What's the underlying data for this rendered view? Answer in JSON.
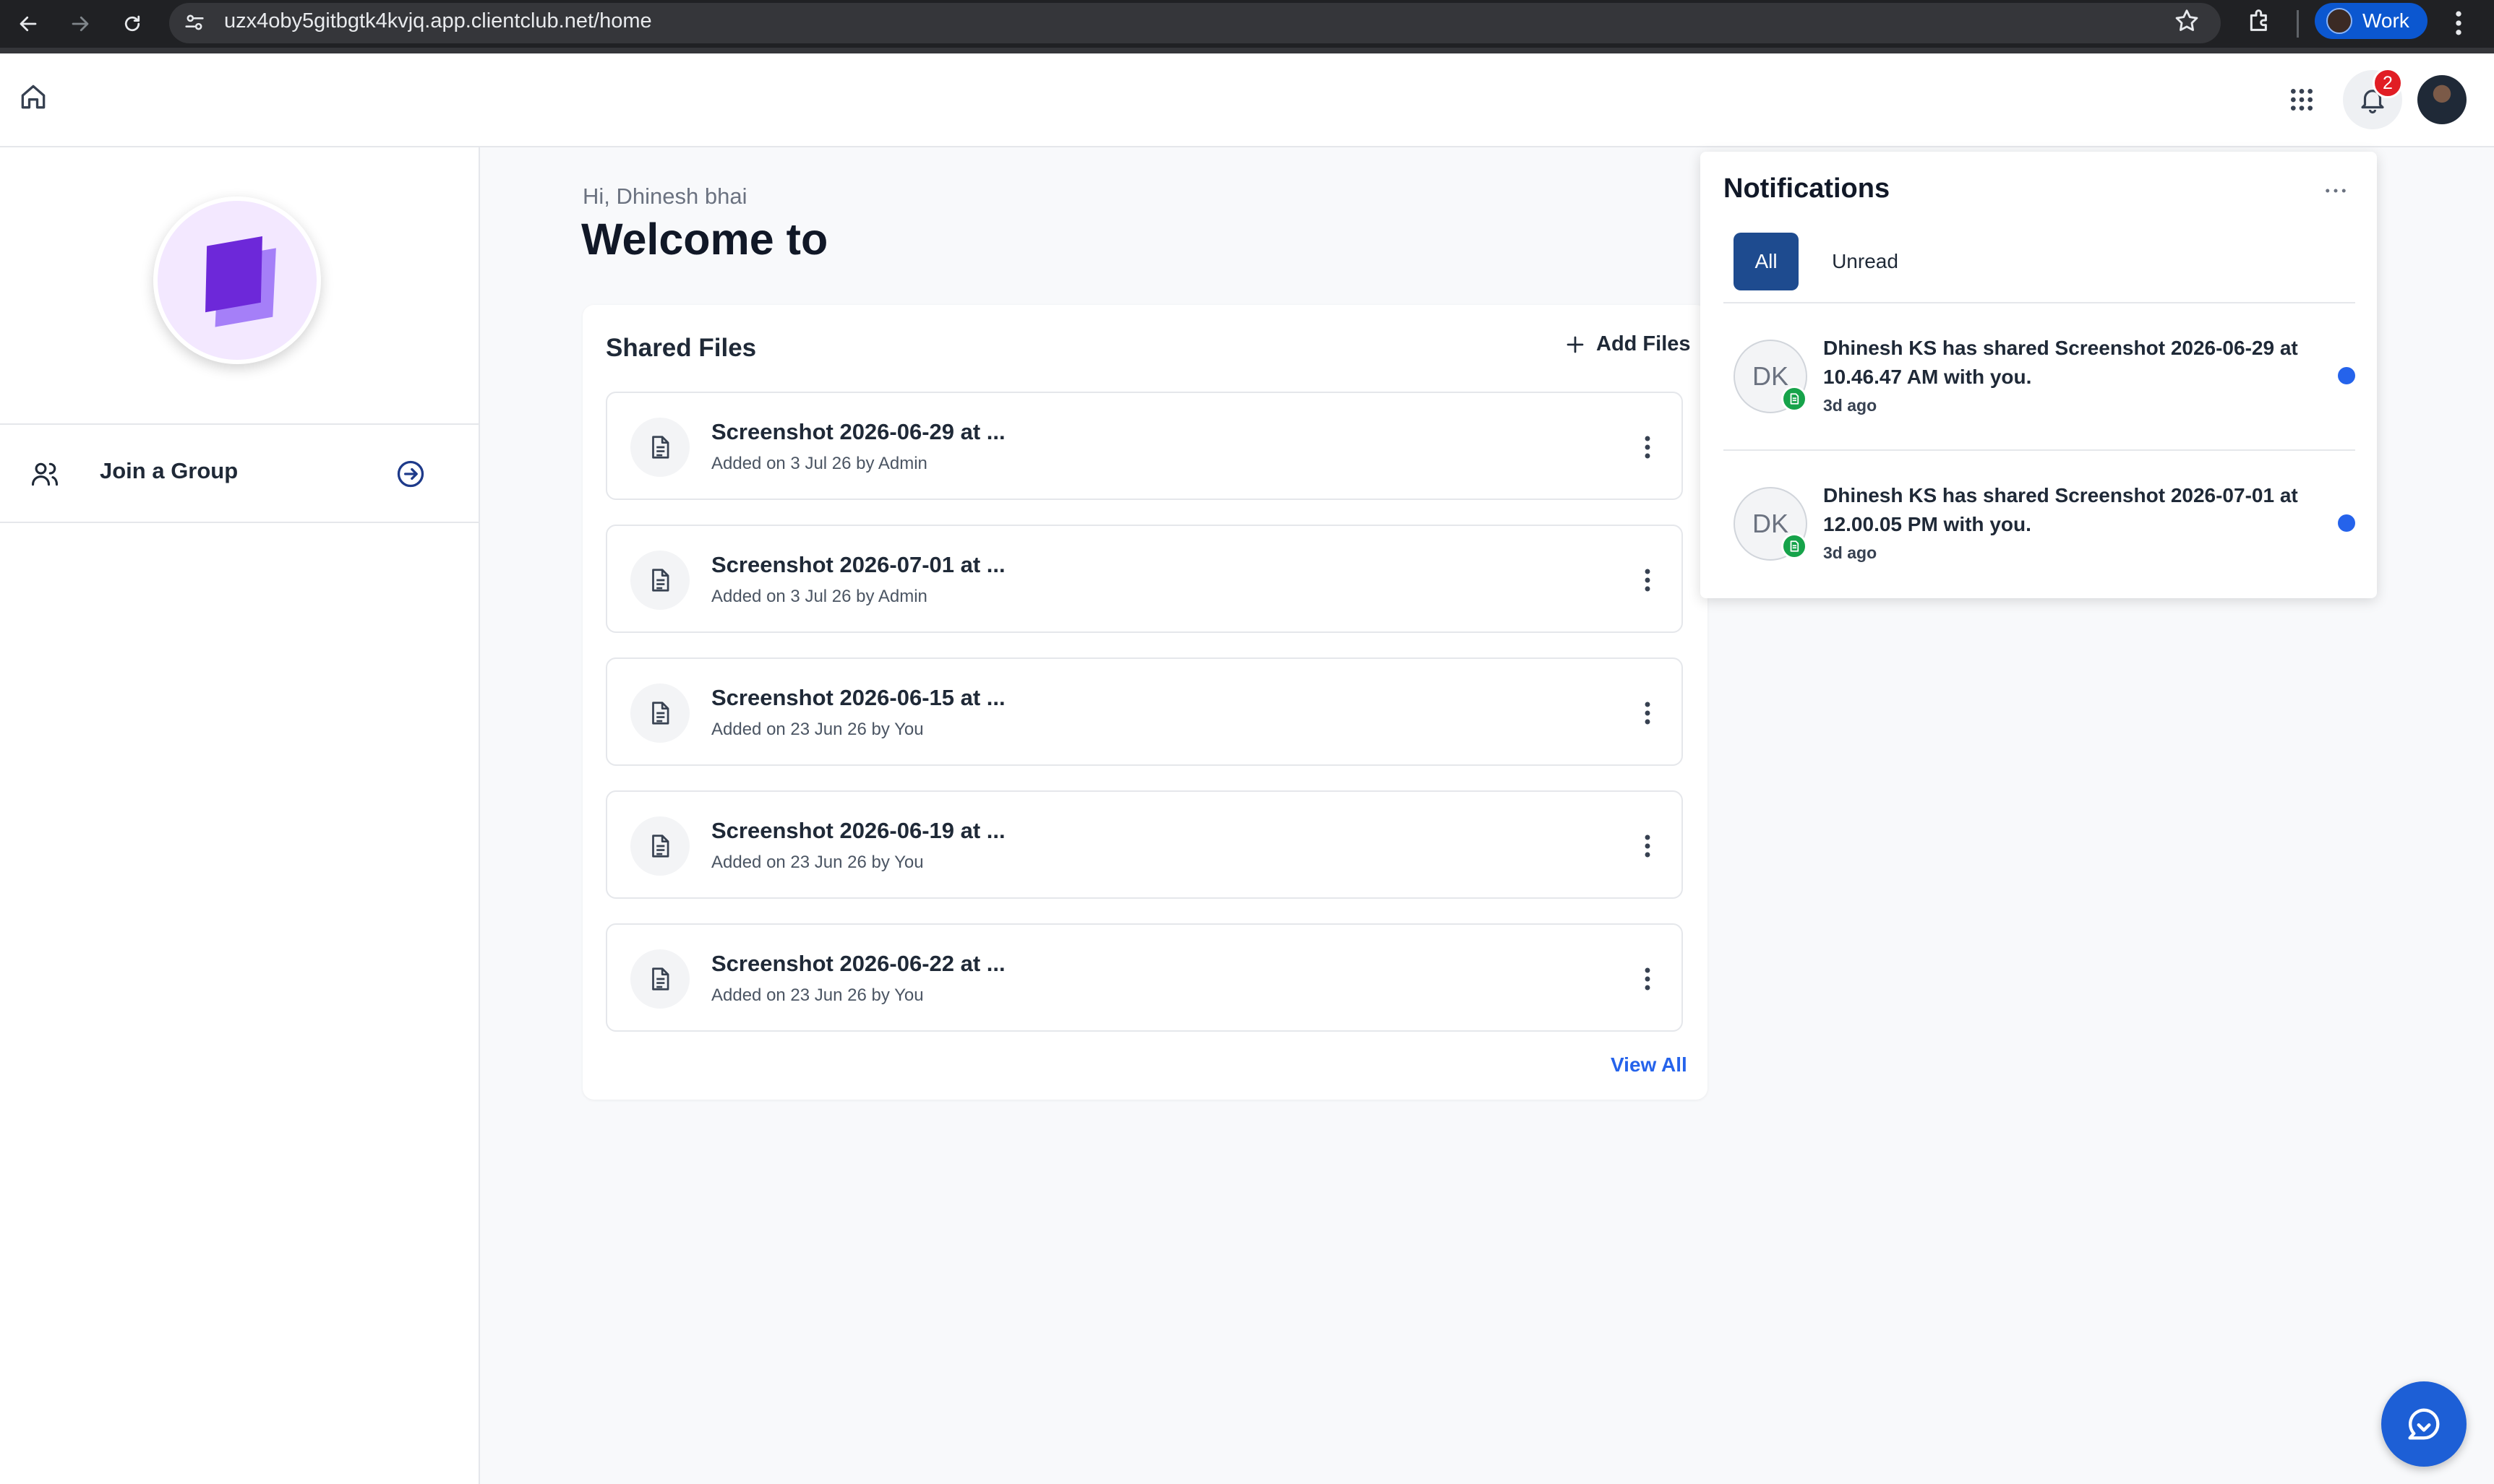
{
  "browser": {
    "url": "uzx4oby5gitbgtk4kvjq.app.clientclub.net/home",
    "profile_label": "Work"
  },
  "header": {
    "notification_count": "2"
  },
  "sidebar": {
    "join_label": "Join a Group"
  },
  "main": {
    "greeting": "Hi, Dhinesh bhai",
    "welcome": "Welcome to",
    "shared_files": {
      "title": "Shared Files",
      "add_label": "Add Files",
      "view_all_label": "View All",
      "files": [
        {
          "name": "Screenshot 2026-06-29 at ...",
          "meta": "Added on 3 Jul 26 by Admin"
        },
        {
          "name": "Screenshot 2026-07-01 at ...",
          "meta": "Added on 3 Jul 26 by Admin"
        },
        {
          "name": "Screenshot 2026-06-15 at ...",
          "meta": "Added on 23 Jun 26 by You"
        },
        {
          "name": "Screenshot 2026-06-19 at ...",
          "meta": "Added on 23 Jun 26 by You"
        },
        {
          "name": "Screenshot 2026-06-22 at ...",
          "meta": "Added on 23 Jun 26 by You"
        }
      ]
    }
  },
  "notifications": {
    "title": "Notifications",
    "tabs": [
      {
        "label": "All"
      },
      {
        "label": "Unread"
      }
    ],
    "items": [
      {
        "initials": "DK",
        "line1": "Dhinesh KS has shared Screenshot 2026-06-29 at",
        "line2": "10.46.47 AM with you.",
        "time": "3d ago"
      },
      {
        "initials": "DK",
        "line1": "Dhinesh KS has shared Screenshot 2026-07-01 at",
        "line2": "12.00.05 PM with you.",
        "time": "3d ago"
      }
    ]
  },
  "colors": {
    "accent": "#1e4b8f",
    "link": "#2563eb",
    "badge": "#e11d24",
    "logo": "#7c3aed"
  }
}
